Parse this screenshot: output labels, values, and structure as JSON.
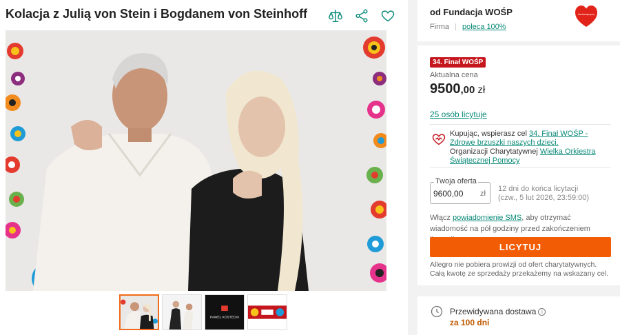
{
  "offer": {
    "title": "Kolacja z Julią von Stein i Bogdanem von Steinhoff",
    "icons": [
      "compare-icon",
      "share-icon",
      "heart-icon"
    ],
    "thumb_labels": [
      "PAWEŁ KOSTECKI"
    ]
  },
  "seller": {
    "name": "od Fundacja WOŚP",
    "type": "Firma",
    "recommend": "poleca 100%",
    "logo_text": "wielka orkiestra świątecznej pomocy"
  },
  "auction": {
    "badge": "34. Finał WOŚP",
    "price_label": "Aktualna cena",
    "price_int": "9500",
    "price_dec": ",00",
    "currency": "zł",
    "bidders": "25 osób licytuje",
    "charity_prefix": "Kupując, wspierasz cel ",
    "charity_goal": "34. Finał WOŚP - Zdrowe brzuszki naszych dzieci.",
    "charity_org_prefix": "Organizacji Charytatywnej ",
    "charity_org": "Wielka Orkiestra Świątecznej Pomocy",
    "bid_label": "Twoja oferta",
    "bid_value": "9600,00",
    "bid_currency": "zł",
    "deadline_line1": "12 dni do końca licytacji",
    "deadline_line2": "(czw., 5 lut 2026, 23:59:00)",
    "sms_prefix": "Włącz ",
    "sms_link": "powiadomienie SMS",
    "sms_suffix": ", aby otrzymać wiadomość na pół godziny przed zakończeniem licytacji.",
    "button": "LICYTUJ",
    "note": "Allegro nie pobiera prowizji od ofert charytatywnych. Całą kwotę ze sprzedaży przekażemy na wskazany cel."
  },
  "delivery": {
    "label": "Przewidywana dostawa",
    "info": "i",
    "time": "za 100 dni"
  },
  "colors": {
    "accent": "#f25c05",
    "link": "#0a8a78",
    "badge": "#c4161c"
  }
}
